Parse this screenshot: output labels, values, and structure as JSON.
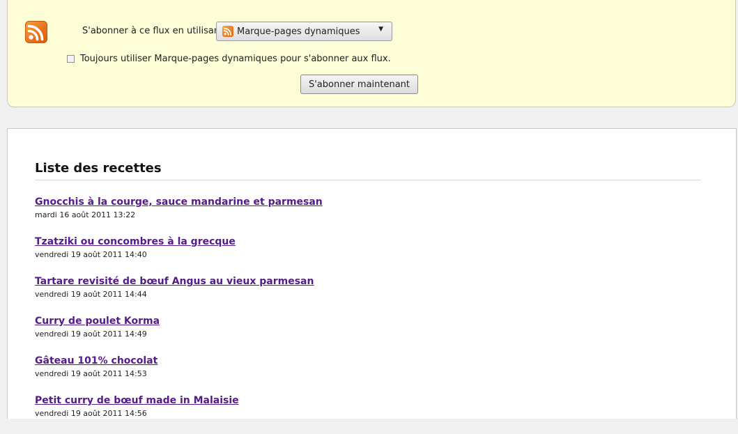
{
  "subscribe": {
    "icon": "rss-feed-icon",
    "label": "S'abonner à ce flux en utilisant",
    "reader": "Marque-pages dynamiques",
    "reader_icon": "rss-feed-icon",
    "always_use_label": "Toujours utiliser Marque-pages dynamiques pour s'abonner aux flux.",
    "always_use_checked": false,
    "subscribe_button": "S'abonner maintenant",
    "accent_color": "#fdfdd8"
  },
  "feed": {
    "title": "Liste des recettes",
    "link_color": "#551a8b",
    "items": [
      {
        "title": "Gnocchis à la courge, sauce mandarine et parmesan",
        "date": "mardi 16 août 2011 13:22"
      },
      {
        "title": "Tzatziki ou concombres à la grecque",
        "date": "vendredi 19 août 2011 14:40"
      },
      {
        "title": "Tartare revisité de bœuf Angus au vieux parmesan",
        "date": "vendredi 19 août 2011 14:44"
      },
      {
        "title": "Curry de poulet Korma",
        "date": "vendredi 19 août 2011 14:49"
      },
      {
        "title": "Gâteau 101% chocolat",
        "date": "vendredi 19 août 2011 14:53"
      },
      {
        "title": "Petit curry de bœuf made in Malaisie",
        "date": "vendredi 19 août 2011 14:56"
      }
    ]
  }
}
